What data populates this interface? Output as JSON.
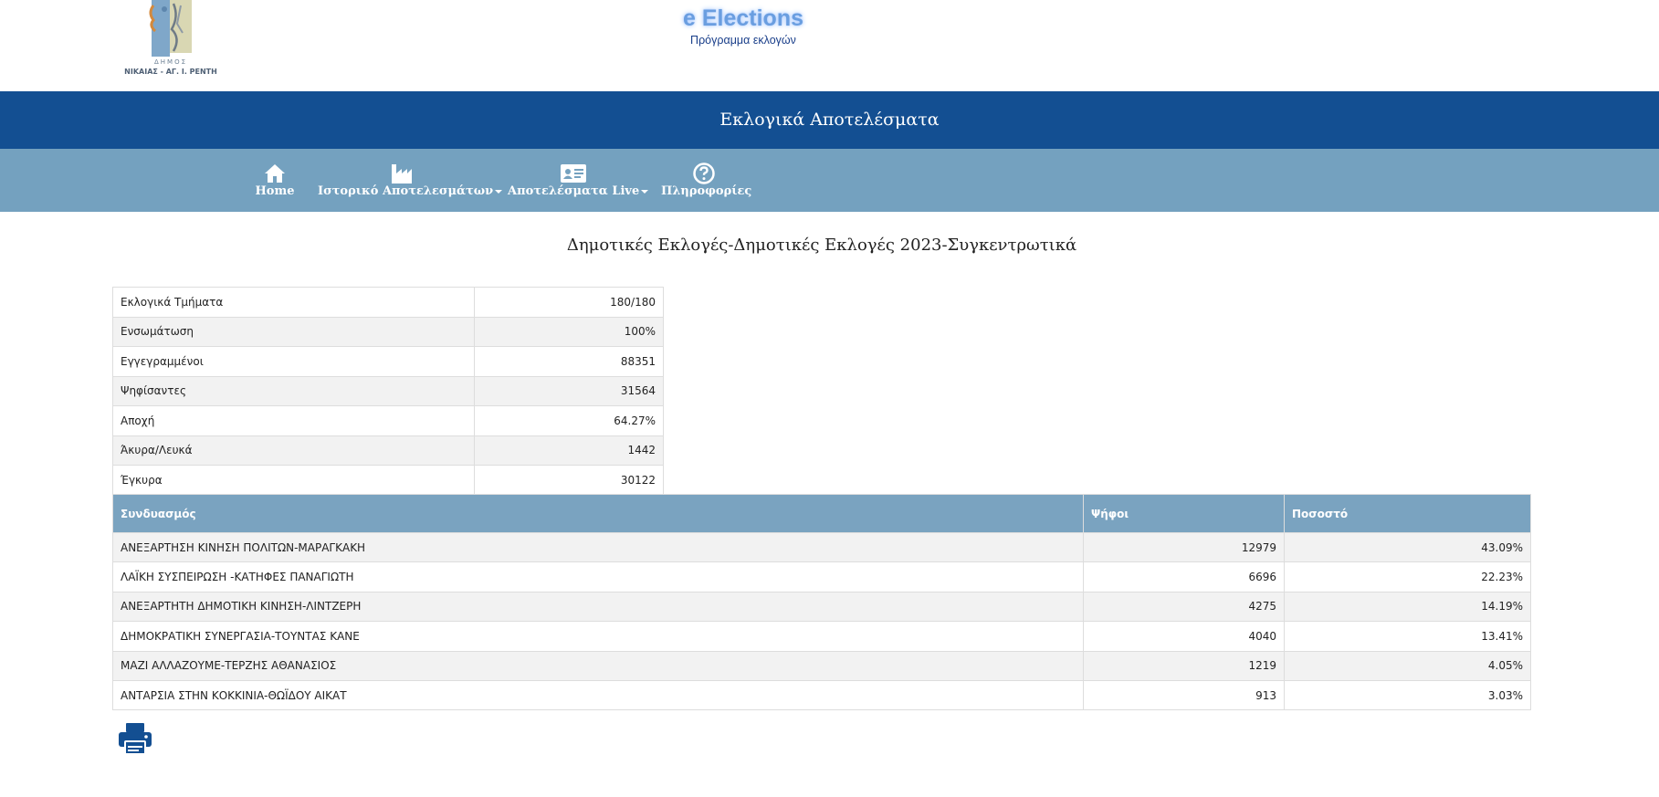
{
  "header": {
    "logo": {
      "line1": "ΔΗΜΟΣ",
      "line2": "ΝΙΚΑΙΑΣ - ΑΓ. Ι. ΡΕΝΤΗ"
    },
    "brand_title": "e Elections",
    "brand_subtitle": "Πρόγραμμα εκλογών"
  },
  "title_bar": "Εκλογικά Αποτελέσματα",
  "nav": [
    {
      "label": "Home",
      "icon": "home-icon"
    },
    {
      "label": "Ιστορικό Αποτελεσμάτων",
      "icon": "industry-icon",
      "dropdown": true
    },
    {
      "label": "Αποτελέσματα Live",
      "icon": "id-card-icon",
      "dropdown": true
    },
    {
      "label": "Πληροφορίες",
      "icon": "question-circle-icon"
    }
  ],
  "page_heading": "Δημοτικές Εκλογές-Δημοτικές Εκλογές 2023-Συγκεντρωτικά",
  "summary": [
    {
      "label": "Εκλογικά Τμήματα",
      "value": "180/180"
    },
    {
      "label": "Ενσωμάτωση",
      "value": "100%"
    },
    {
      "label": "Εγγεγραμμένοι",
      "value": "88351"
    },
    {
      "label": "Ψηφίσαντες",
      "value": "31564"
    },
    {
      "label": "Αποχή",
      "value": "64.27%"
    },
    {
      "label": "Άκυρα/Λευκά",
      "value": "1442"
    },
    {
      "label": "Έγκυρα",
      "value": "30122"
    }
  ],
  "results": {
    "headers": [
      "Συνδυασμός",
      "Ψήφοι",
      "Ποσοστό"
    ],
    "rows": [
      [
        "ΑΝΕΞΑΡΤΗΣΗ ΚΙΝΗΣΗ ΠΟΛΙΤΩΝ-ΜΑΡΑΓΚΑΚΗ",
        "12979",
        "43.09%"
      ],
      [
        "ΛΑΪΚΗ ΣΥΣΠΕΙΡΩΣΗ -ΚΑΤΗΦΕΣ ΠΑΝΑΓΙΩΤΗ",
        "6696",
        "22.23%"
      ],
      [
        "ΑΝΕΞΑΡΤΗΤΗ ΔΗΜΟΤΙΚΗ ΚΙΝΗΣΗ-ΛΙΝΤΖΕΡΗ",
        "4275",
        "14.19%"
      ],
      [
        "ΔΗΜΟΚΡΑΤΙΚΗ ΣΥΝΕΡΓΑΣΙΑ-ΤΟΥΝΤΑΣ ΚΑΝΕ",
        "4040",
        "13.41%"
      ],
      [
        "ΜΑΖΙ ΑΛΛΑΖΟΥΜΕ-ΤΕΡΖΗΣ ΑΘΑΝΑΣΙΟΣ",
        "1219",
        "4.05%"
      ],
      [
        "ΑΝΤΑΡΣΙΑ ΣΤΗΝ ΚΟΚΚΙΝΙΑ-ΘΩΪΔΟΥ ΑΙΚΑΤ",
        "913",
        "3.03%"
      ]
    ]
  },
  "colors": {
    "title_bar": "#134f92",
    "nav_bar": "#74a1bf",
    "table_header": "#7aa3c0",
    "print_icon": "#134f92"
  },
  "print_icon": "printer-icon"
}
